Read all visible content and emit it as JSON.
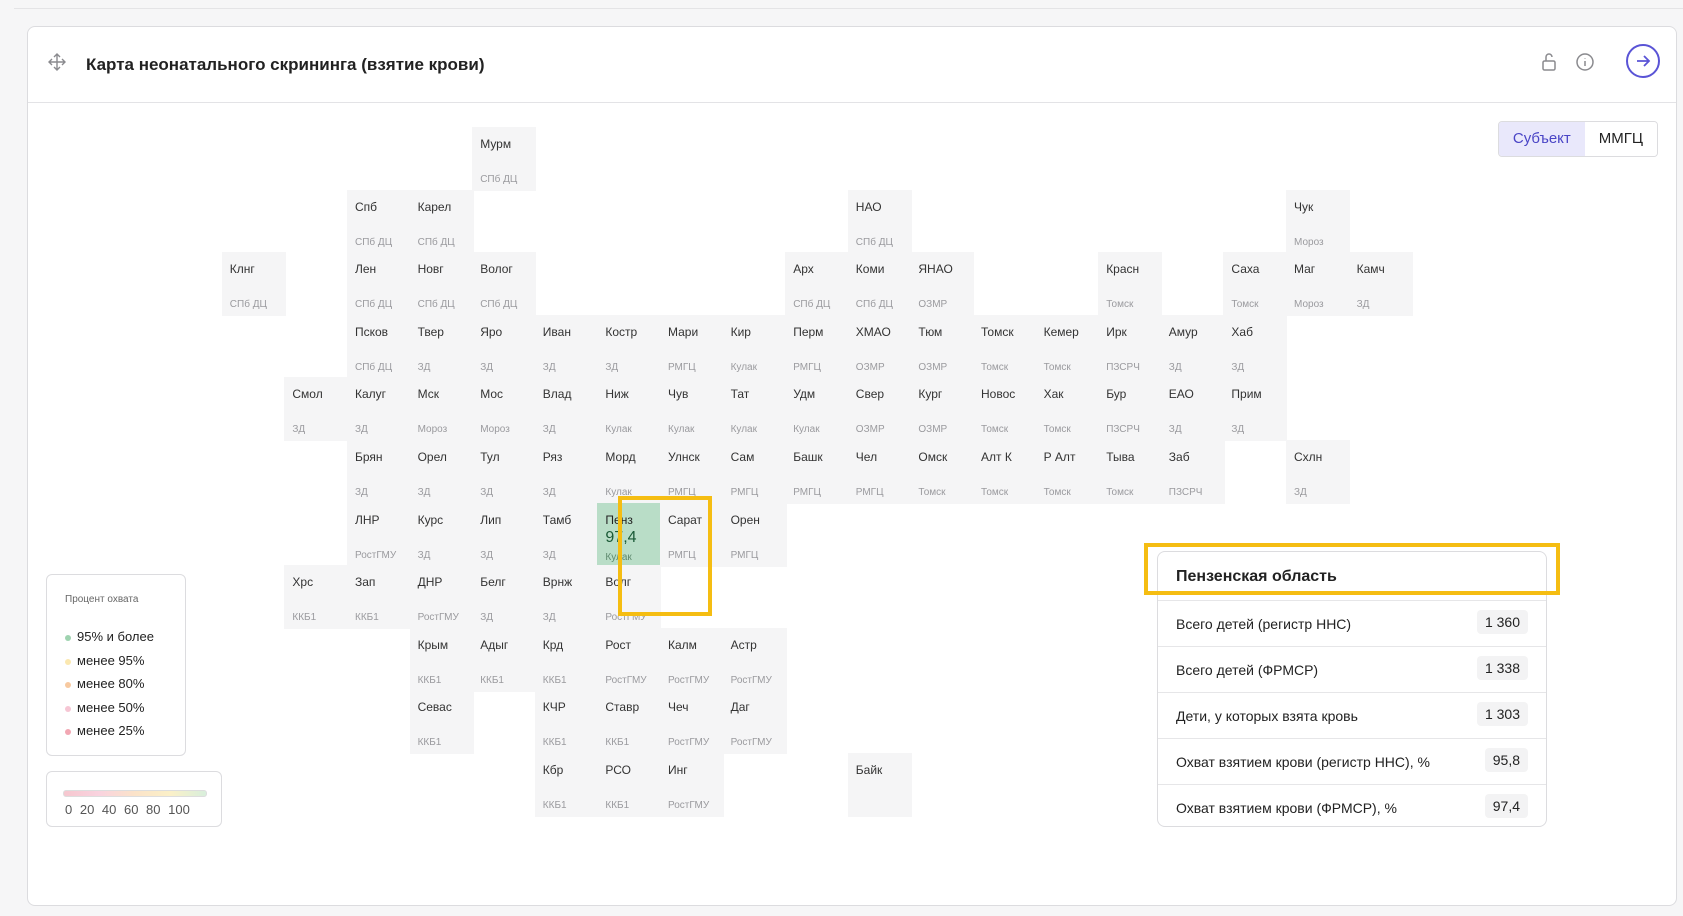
{
  "header": {
    "title": "Карта неонатального скрининга (взятие крови)"
  },
  "toggle": {
    "left": "Субъект",
    "right": "ММГЦ",
    "active": "left"
  },
  "map_cells": [
    {
      "n": "Мурм",
      "s": "СПб ДЦ",
      "c": 7,
      "r": 0
    },
    {
      "n": "Спб",
      "s": "СПб ДЦ",
      "c": 5,
      "r": 1
    },
    {
      "n": "Карел",
      "s": "СПб ДЦ",
      "c": 6,
      "r": 1
    },
    {
      "n": "НАО",
      "s": "СПб ДЦ",
      "c": 13,
      "r": 1
    },
    {
      "n": "Чук",
      "s": "Мороз",
      "c": 20,
      "r": 1
    },
    {
      "n": "Клнг",
      "s": "СПб ДЦ",
      "c": 3,
      "r": 2
    },
    {
      "n": "Лен",
      "s": "СПб ДЦ",
      "c": 5,
      "r": 2
    },
    {
      "n": "Новг",
      "s": "СПб ДЦ",
      "c": 6,
      "r": 2
    },
    {
      "n": "Волог",
      "s": "СПб ДЦ",
      "c": 7,
      "r": 2
    },
    {
      "n": "Арх",
      "s": "СПб ДЦ",
      "c": 12,
      "r": 2
    },
    {
      "n": "Коми",
      "s": "СПб ДЦ",
      "c": 13,
      "r": 2
    },
    {
      "n": "ЯНАО",
      "s": "ОЗМР",
      "c": 14,
      "r": 2
    },
    {
      "n": "Красн",
      "s": "Томск",
      "c": 17,
      "r": 2
    },
    {
      "n": "Саха",
      "s": "Томск",
      "c": 19,
      "r": 2
    },
    {
      "n": "Маг",
      "s": "Мороз",
      "c": 20,
      "r": 2
    },
    {
      "n": "Камч",
      "s": "ЗД",
      "c": 21,
      "r": 2
    },
    {
      "n": "Псков",
      "s": "СПб ДЦ",
      "c": 5,
      "r": 3
    },
    {
      "n": "Твер",
      "s": "ЗД",
      "c": 6,
      "r": 3
    },
    {
      "n": "Яро",
      "s": "ЗД",
      "c": 7,
      "r": 3
    },
    {
      "n": "Иван",
      "s": "ЗД",
      "c": 8,
      "r": 3
    },
    {
      "n": "Костр",
      "s": "ЗД",
      "c": 9,
      "r": 3
    },
    {
      "n": "Мари",
      "s": "РМГЦ",
      "c": 10,
      "r": 3
    },
    {
      "n": "Кир",
      "s": "Кулак",
      "c": 11,
      "r": 3
    },
    {
      "n": "Перм",
      "s": "РМГЦ",
      "c": 12,
      "r": 3
    },
    {
      "n": "ХМАО",
      "s": "ОЗМР",
      "c": 13,
      "r": 3
    },
    {
      "n": "Тюм",
      "s": "ОЗМР",
      "c": 14,
      "r": 3
    },
    {
      "n": "Томск",
      "s": "Томск",
      "c": 15,
      "r": 3
    },
    {
      "n": "Кемер",
      "s": "Томск",
      "c": 16,
      "r": 3
    },
    {
      "n": "Ирк",
      "s": "ПЗСРЧ",
      "c": 17,
      "r": 3
    },
    {
      "n": "Амур",
      "s": "ЗД",
      "c": 18,
      "r": 3
    },
    {
      "n": "Хаб",
      "s": "ЗД",
      "c": 19,
      "r": 3
    },
    {
      "n": "Смол",
      "s": "ЗД",
      "c": 4,
      "r": 4
    },
    {
      "n": "Калуг",
      "s": "ЗД",
      "c": 5,
      "r": 4
    },
    {
      "n": "Мск",
      "s": "Мороз",
      "c": 6,
      "r": 4
    },
    {
      "n": "Мос",
      "s": "Мороз",
      "c": 7,
      "r": 4
    },
    {
      "n": "Влад",
      "s": "ЗД",
      "c": 8,
      "r": 4
    },
    {
      "n": "Ниж",
      "s": "Кулак",
      "c": 9,
      "r": 4
    },
    {
      "n": "Чув",
      "s": "Кулак",
      "c": 10,
      "r": 4
    },
    {
      "n": "Тат",
      "s": "Кулак",
      "c": 11,
      "r": 4
    },
    {
      "n": "Удм",
      "s": "Кулак",
      "c": 12,
      "r": 4
    },
    {
      "n": "Свер",
      "s": "ОЗМР",
      "c": 13,
      "r": 4
    },
    {
      "n": "Кург",
      "s": "ОЗМР",
      "c": 14,
      "r": 4
    },
    {
      "n": "Новос",
      "s": "Томск",
      "c": 15,
      "r": 4
    },
    {
      "n": "Хак",
      "s": "Томск",
      "c": 16,
      "r": 4
    },
    {
      "n": "Бур",
      "s": "ПЗСРЧ",
      "c": 17,
      "r": 4
    },
    {
      "n": "ЕАО",
      "s": "ЗД",
      "c": 18,
      "r": 4
    },
    {
      "n": "Прим",
      "s": "ЗД",
      "c": 19,
      "r": 4
    },
    {
      "n": "Брян",
      "s": "ЗД",
      "c": 5,
      "r": 5
    },
    {
      "n": "Орел",
      "s": "ЗД",
      "c": 6,
      "r": 5
    },
    {
      "n": "Тул",
      "s": "ЗД",
      "c": 7,
      "r": 5
    },
    {
      "n": "Ряз",
      "s": "ЗД",
      "c": 8,
      "r": 5
    },
    {
      "n": "Морд",
      "s": "Кулак",
      "c": 9,
      "r": 5
    },
    {
      "n": "Улнск",
      "s": "РМГЦ",
      "c": 10,
      "r": 5
    },
    {
      "n": "Сам",
      "s": "РМГЦ",
      "c": 11,
      "r": 5
    },
    {
      "n": "Башк",
      "s": "РМГЦ",
      "c": 12,
      "r": 5
    },
    {
      "n": "Чел",
      "s": "РМГЦ",
      "c": 13,
      "r": 5
    },
    {
      "n": "Омск",
      "s": "Томск",
      "c": 14,
      "r": 5
    },
    {
      "n": "Алт К",
      "s": "Томск",
      "c": 15,
      "r": 5
    },
    {
      "n": "Р Алт",
      "s": "Томск",
      "c": 16,
      "r": 5
    },
    {
      "n": "Тыва",
      "s": "Томск",
      "c": 17,
      "r": 5
    },
    {
      "n": "Заб",
      "s": "ПЗСРЧ",
      "c": 18,
      "r": 5
    },
    {
      "n": "Схлн",
      "s": "ЗД",
      "c": 20,
      "r": 5
    },
    {
      "n": "ЛНР",
      "s": "РостГМУ",
      "c": 5,
      "r": 6
    },
    {
      "n": "Курс",
      "s": "ЗД",
      "c": 6,
      "r": 6
    },
    {
      "n": "Лип",
      "s": "ЗД",
      "c": 7,
      "r": 6
    },
    {
      "n": "Тамб",
      "s": "ЗД",
      "c": 8,
      "r": 6
    },
    {
      "n": "Пенз",
      "s": "Кулак",
      "v": "97,4",
      "sel": true,
      "c": 9,
      "r": 6
    },
    {
      "n": "Сарат",
      "s": "РМГЦ",
      "c": 10,
      "r": 6
    },
    {
      "n": "Орен",
      "s": "РМГЦ",
      "c": 11,
      "r": 6
    },
    {
      "n": "Хрс",
      "s": "ККБ1",
      "c": 4,
      "r": 7
    },
    {
      "n": "Зап",
      "s": "ККБ1",
      "c": 5,
      "r": 7
    },
    {
      "n": "ДНР",
      "s": "РостГМУ",
      "c": 6,
      "r": 7
    },
    {
      "n": "Белг",
      "s": "ЗД",
      "c": 7,
      "r": 7
    },
    {
      "n": "Врнж",
      "s": "ЗД",
      "c": 8,
      "r": 7
    },
    {
      "n": "Волг",
      "s": "РостГМУ",
      "c": 9,
      "r": 7
    },
    {
      "n": "Крым",
      "s": "ККБ1",
      "c": 6,
      "r": 8
    },
    {
      "n": "Адыг",
      "s": "ККБ1",
      "c": 7,
      "r": 8
    },
    {
      "n": "Крд",
      "s": "ККБ1",
      "c": 8,
      "r": 8
    },
    {
      "n": "Рост",
      "s": "РостГМУ",
      "c": 9,
      "r": 8
    },
    {
      "n": "Калм",
      "s": "РостГМУ",
      "c": 10,
      "r": 8
    },
    {
      "n": "Астр",
      "s": "РостГМУ",
      "c": 11,
      "r": 8
    },
    {
      "n": "Севас",
      "s": "ККБ1",
      "c": 6,
      "r": 9
    },
    {
      "n": "КЧР",
      "s": "ККБ1",
      "c": 8,
      "r": 9
    },
    {
      "n": "Ставр",
      "s": "ККБ1",
      "c": 9,
      "r": 9
    },
    {
      "n": "Чеч",
      "s": "РостГМУ",
      "c": 10,
      "r": 9
    },
    {
      "n": "Даг",
      "s": "РостГМУ",
      "c": 11,
      "r": 9
    },
    {
      "n": "Кбр",
      "s": "ККБ1",
      "c": 8,
      "r": 10
    },
    {
      "n": "РСО",
      "s": "ККБ1",
      "c": 9,
      "r": 10
    },
    {
      "n": "Инг",
      "s": "РостГМУ",
      "c": 10,
      "r": 10
    },
    {
      "n": "Байк",
      "s": "",
      "c": 13,
      "r": 10
    }
  ],
  "legend": {
    "title": "Процент охвата",
    "items": [
      {
        "label": "95% и более",
        "color": "#9fd3b0"
      },
      {
        "label": "менее 95%",
        "color": "#fbe8b0"
      },
      {
        "label": "менее 80%",
        "color": "#f7c9a0"
      },
      {
        "label": "менее 50%",
        "color": "#f6c6d4"
      },
      {
        "label": "менее 25%",
        "color": "#f2a7b3"
      }
    ]
  },
  "scale": {
    "ticks": "0 20 40 60 80 100"
  },
  "info": {
    "title": "Пензенская область",
    "rows": [
      {
        "label": "Всего детей (регистр ННС)",
        "value": "1 360"
      },
      {
        "label": "Всего детей (ФРМСР)",
        "value": "1 338"
      },
      {
        "label": "Дети, у которых взята кровь",
        "value": "1 303"
      },
      {
        "label": "Охват взятием крови (регистр ННС), %",
        "value": "95,8"
      },
      {
        "label": "Охват взятием крови (ФРМСР), %",
        "value": "97,4"
      }
    ]
  }
}
